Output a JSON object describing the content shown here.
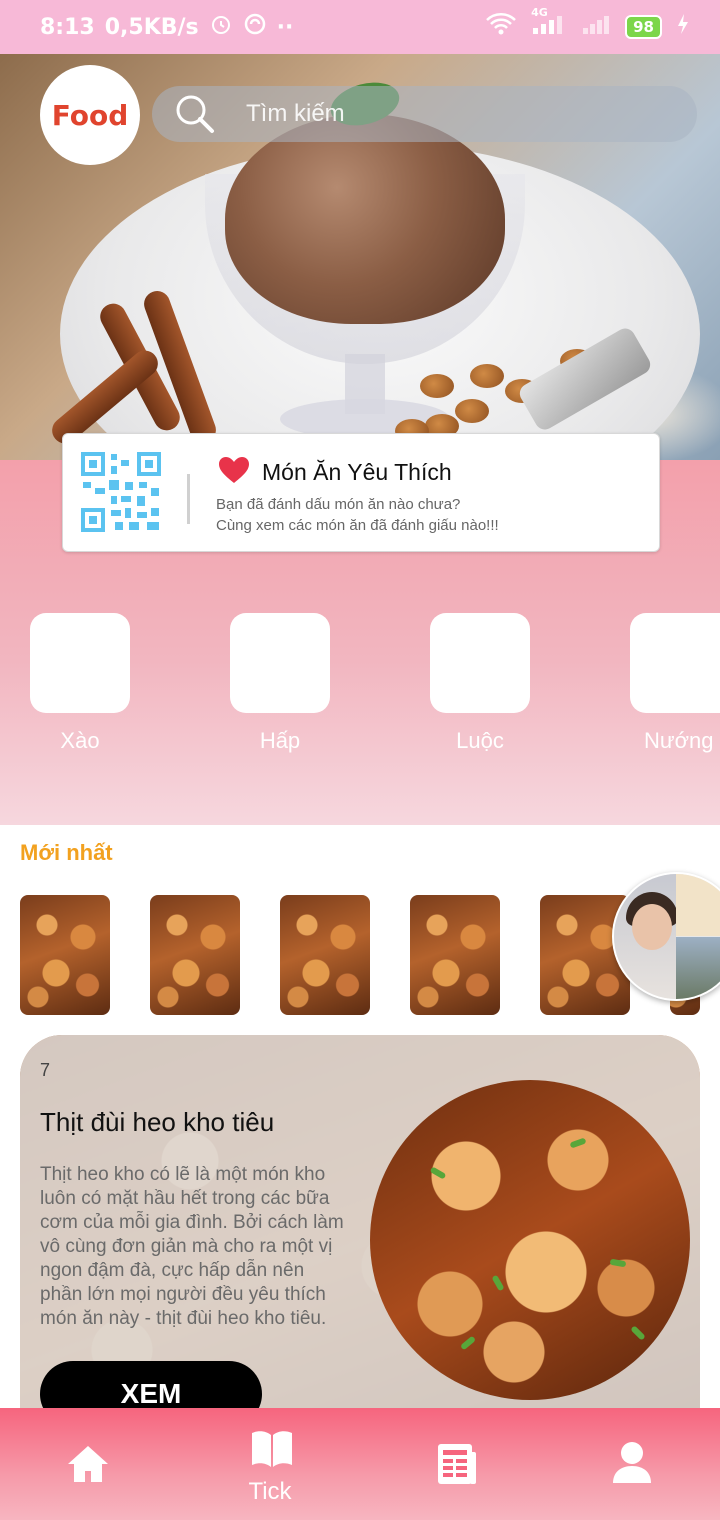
{
  "statusbar": {
    "time": "8:13",
    "speed": "0,5KB/s",
    "network": "4G",
    "battery": "98"
  },
  "header": {
    "logo_text": "Food",
    "search_placeholder": "Tìm kiếm"
  },
  "favorites": {
    "title": "Món Ăn Yêu Thích",
    "line1": "Bạn đã đánh dấu món ăn nào chưa?",
    "line2": "Cùng xem các món ăn đã đánh giấu nào!!!"
  },
  "categories": [
    {
      "label": "Xào"
    },
    {
      "label": "Hấp"
    },
    {
      "label": "Luộc"
    },
    {
      "label": "Nướng"
    }
  ],
  "newest": {
    "title": "Mới nhất"
  },
  "featured": {
    "number": "7",
    "title": "Thịt đùi heo kho tiêu",
    "description": "Thịt heo kho có lẽ là một món kho luôn có mặt hầu hết trong các bữa cơm của mỗi gia đình. Bởi cách làm vô cùng đơn giản mà cho ra một vị ngon đậm đà, cực hấp dẫn nên phần lớn mọi người đều yêu thích món ăn này - thịt đùi heo kho tiêu.",
    "button": "XEM"
  },
  "bottom_nav": {
    "items": [
      {
        "icon": "home-icon",
        "label": ""
      },
      {
        "icon": "book-icon",
        "label": "Tick"
      },
      {
        "icon": "news-icon",
        "label": ""
      },
      {
        "icon": "user-icon",
        "label": ""
      }
    ]
  },
  "colors": {
    "statusbar": "#f7b9d7",
    "accent_orange": "#f2a11f",
    "heart": "#e8334a",
    "nav": "#f6657e",
    "qr": "#5bc3f0"
  }
}
